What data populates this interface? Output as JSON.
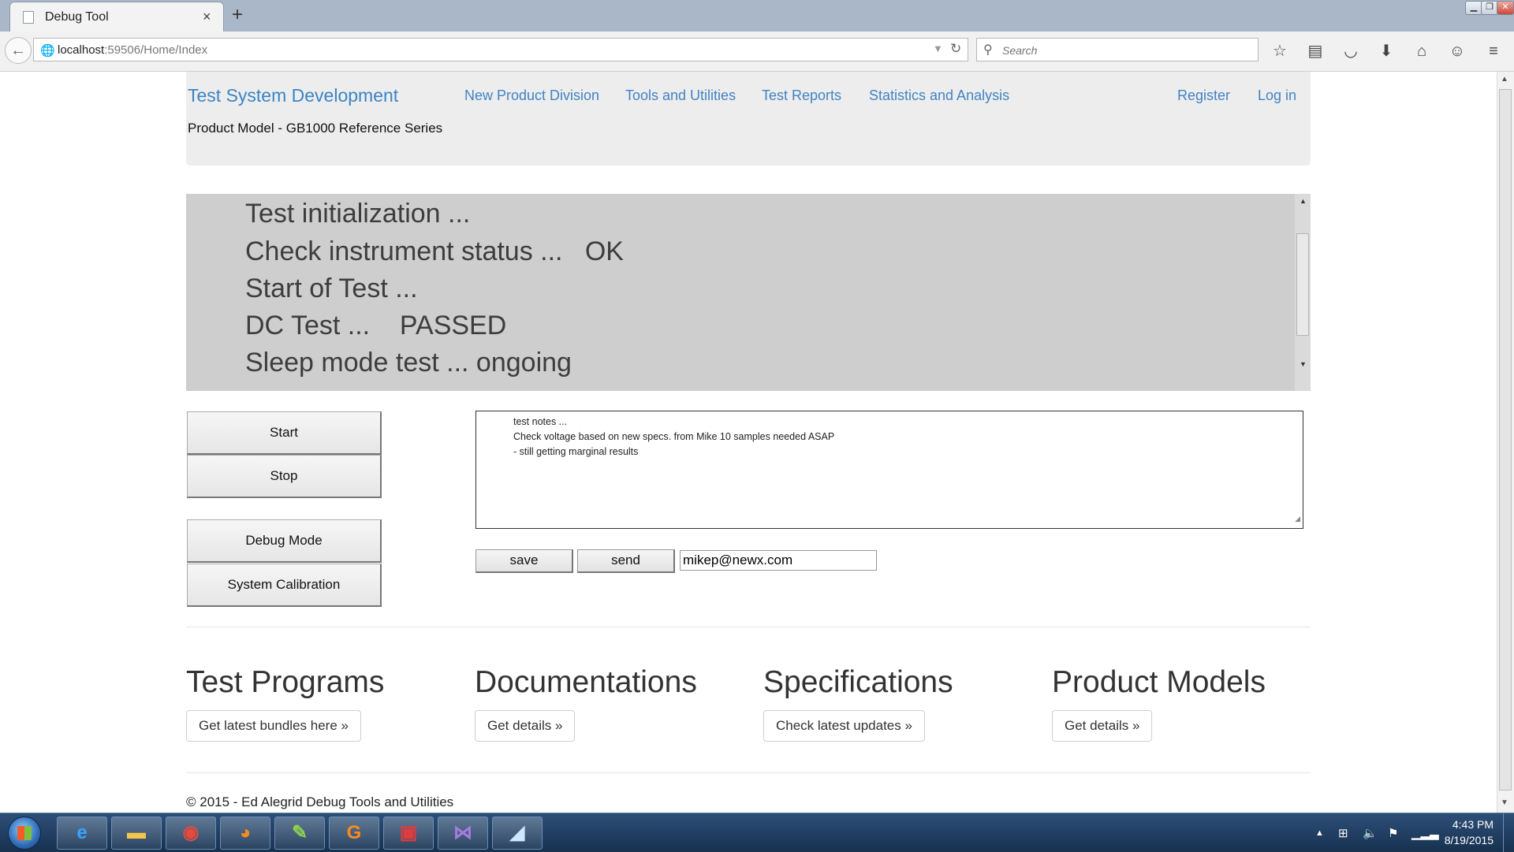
{
  "browser": {
    "tab_title": "Debug Tool",
    "tab_close": "×",
    "new_tab": "+",
    "url_host": "localhost",
    "url_rest": ":59506/Home/Index",
    "search_placeholder": "Search",
    "toolbar_icons": [
      "bookmark-star-icon",
      "reading-list-icon",
      "pocket-icon",
      "download-icon",
      "home-icon",
      "chat-icon",
      "menu-icon"
    ]
  },
  "site": {
    "brand": "Test System Development",
    "nav": [
      "New Product Division",
      "Tools and Utilities",
      "Test Reports",
      "Statistics and Analysis"
    ],
    "register": "Register",
    "login": "Log in",
    "subtitle": "Product Model - GB1000 Reference Series"
  },
  "console": {
    "lines": [
      "Test initialization ...",
      "Check instrument status ...   OK",
      "Start of Test ...",
      "DC Test ...    PASSED",
      "Sleep mode test ... ongoing"
    ]
  },
  "controls": {
    "start": "Start",
    "stop": "Stop",
    "debug_mode": "Debug Mode",
    "system_calibration": "System Calibration"
  },
  "notes": {
    "lines": [
      "test notes ...",
      "Check voltage based on new specs.  from Mike 10 samples  needed ASAP",
      "- still getting marginal results"
    ],
    "save": "save",
    "send": "send",
    "email": "mikep@newx.com"
  },
  "sections": [
    {
      "title": "Test Programs",
      "button": "Get latest bundles here »"
    },
    {
      "title": "Documentations",
      "button": "Get details »"
    },
    {
      "title": "Specifications",
      "button": "Check latest updates »"
    },
    {
      "title": "Product Models",
      "button": "Get details »"
    }
  ],
  "footer": "© 2015 - Ed Alegrid Debug Tools and Utilities",
  "taskbar": {
    "apps": [
      "internet-explorer-icon",
      "file-explorer-icon",
      "chrome-icon",
      "firefox-icon",
      "notepad-plus-icon",
      "pdf-tool-icon",
      "toolbox-icon",
      "visual-studio-icon",
      "remote-desktop-icon"
    ],
    "time": "4:43 PM",
    "date": "8/19/2015"
  }
}
